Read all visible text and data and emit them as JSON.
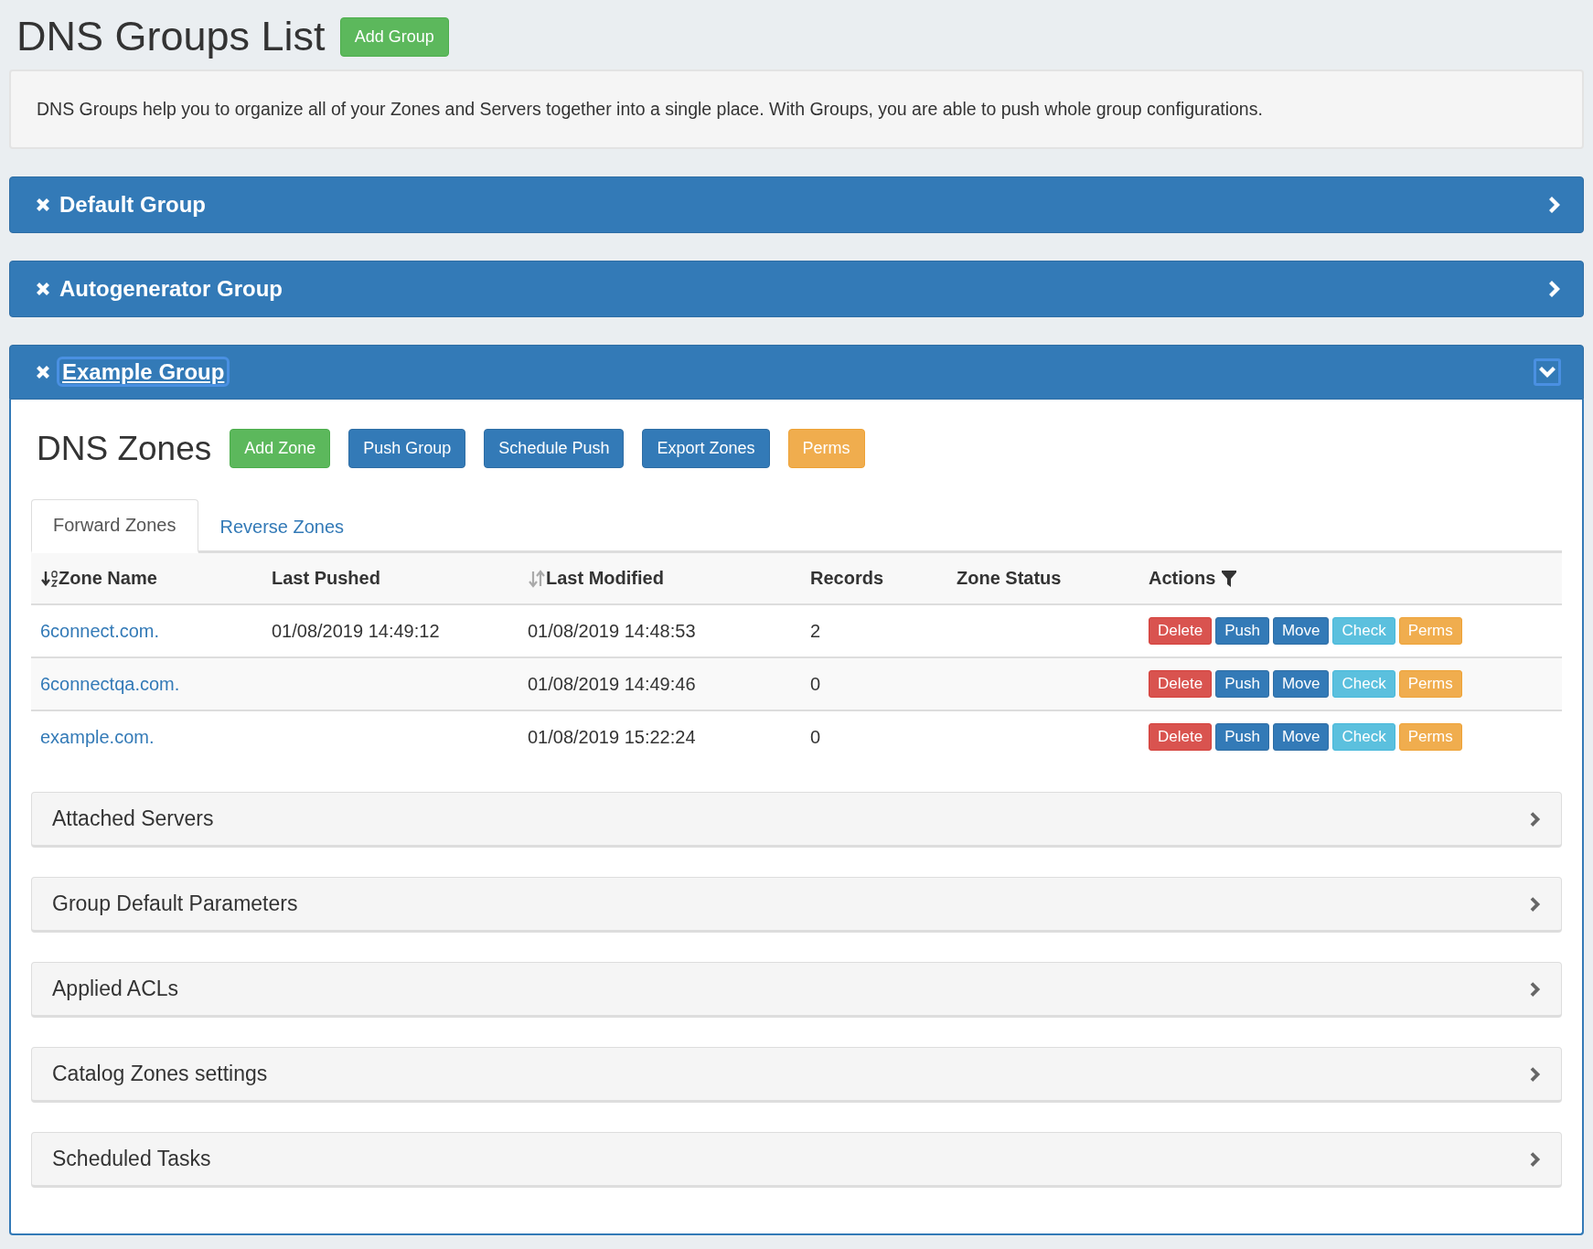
{
  "page": {
    "title": "DNS Groups List",
    "add_button": "Add Group"
  },
  "description": "DNS Groups help you to organize all of your Zones and Servers together into a single place. With Groups, you are able to push whole group configurations.",
  "groups": [
    {
      "name": "Default Group",
      "expanded": false
    },
    {
      "name": "Autogenerator Group",
      "expanded": false
    },
    {
      "name": "Example Group",
      "expanded": true,
      "content": {
        "heading": "DNS Zones",
        "buttons": [
          {
            "label": "Add Zone",
            "kind": "success"
          },
          {
            "label": "Push Group",
            "kind": "primary"
          },
          {
            "label": "Schedule Push",
            "kind": "primary"
          },
          {
            "label": "Export Zones",
            "kind": "primary"
          },
          {
            "label": "Perms",
            "kind": "warning"
          }
        ],
        "tabs": [
          {
            "label": "Forward Zones",
            "selected": true
          },
          {
            "label": "Reverse Zones",
            "selected": false
          }
        ],
        "table": {
          "columns": [
            {
              "label": "Zone Name",
              "kind": "sort-alpha"
            },
            {
              "label": "Last Pushed",
              "kind": "plain"
            },
            {
              "label": "Last Modified",
              "kind": "sort"
            },
            {
              "label": "Records",
              "kind": "plain"
            },
            {
              "label": "Zone Status",
              "kind": "plain"
            },
            {
              "label": "Actions",
              "kind": "filter"
            }
          ],
          "rows": [
            {
              "zone": "6connect.com.",
              "last_pushed": "01/08/2019 14:49:12",
              "last_modified": "01/08/2019 14:48:53",
              "records": "2",
              "actions": [
                {
                  "label": "Delete",
                  "kind": "danger"
                },
                {
                  "label": "Push",
                  "kind": "primary"
                },
                {
                  "label": "Move",
                  "kind": "primary"
                },
                {
                  "label": "Check",
                  "kind": "info"
                },
                {
                  "label": "Perms",
                  "kind": "warning"
                }
              ]
            },
            {
              "zone": "6connectqa.com.",
              "last_modified": "01/08/2019 14:49:46",
              "records": "0",
              "actions": [
                {
                  "label": "Delete",
                  "kind": "danger"
                },
                {
                  "label": "Push",
                  "kind": "primary"
                },
                {
                  "label": "Move",
                  "kind": "primary"
                },
                {
                  "label": "Check",
                  "kind": "info"
                },
                {
                  "label": "Perms",
                  "kind": "warning"
                }
              ]
            },
            {
              "zone": "example.com.",
              "last_modified": "01/08/2019 15:22:24",
              "records": "0",
              "actions": [
                {
                  "label": "Delete",
                  "kind": "danger"
                },
                {
                  "label": "Push",
                  "kind": "primary"
                },
                {
                  "label": "Move",
                  "kind": "primary"
                },
                {
                  "label": "Check",
                  "kind": "info"
                },
                {
                  "label": "Perms",
                  "kind": "warning"
                }
              ]
            }
          ]
        },
        "sections": [
          {
            "title": "Attached Servers",
            "expanded": false
          },
          {
            "title": "Group Default Parameters",
            "expanded": false
          },
          {
            "title": "Applied ACLs",
            "expanded": false
          },
          {
            "title": "Catalog Zones settings",
            "expanded": false
          },
          {
            "title": "Scheduled Tasks",
            "expanded": false
          }
        ]
      }
    }
  ]
}
